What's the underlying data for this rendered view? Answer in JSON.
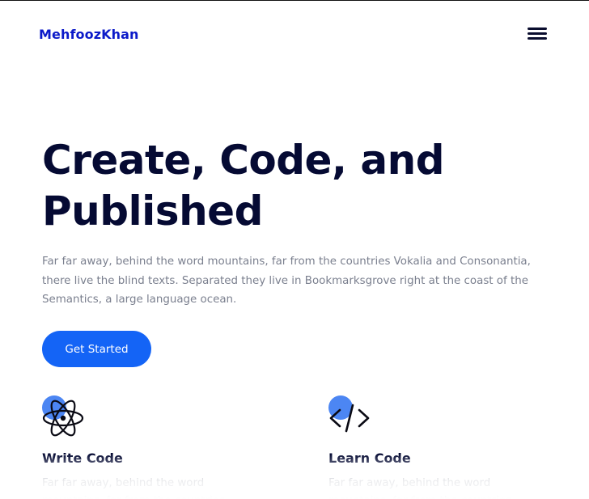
{
  "header": {
    "brand": "MehfoozKhan",
    "menu_icon": "hamburger-menu-icon"
  },
  "hero": {
    "title": "Create, Code, and Published",
    "description": "Far far away, behind the word mountains, far from the countries Vokalia and Consonantia, there live the blind texts. Separated they live in Bookmarksgrove right at the coast of the Semantics, a large language ocean.",
    "cta_label": "Get Started"
  },
  "features": [
    {
      "icon": "atom-icon",
      "title": "Write Code",
      "text": "Far far away, behind the word mountains, far from the countries"
    },
    {
      "icon": "code-brackets-icon",
      "title": "Learn Code",
      "text": "Far far away, behind the word mountains, far from the countries"
    }
  ],
  "colors": {
    "brand": "#0b1ac9",
    "accent": "#1464f6",
    "heading": "#050a33",
    "body_text": "#7a7f8e",
    "icon_dot": "#4c86f3"
  }
}
